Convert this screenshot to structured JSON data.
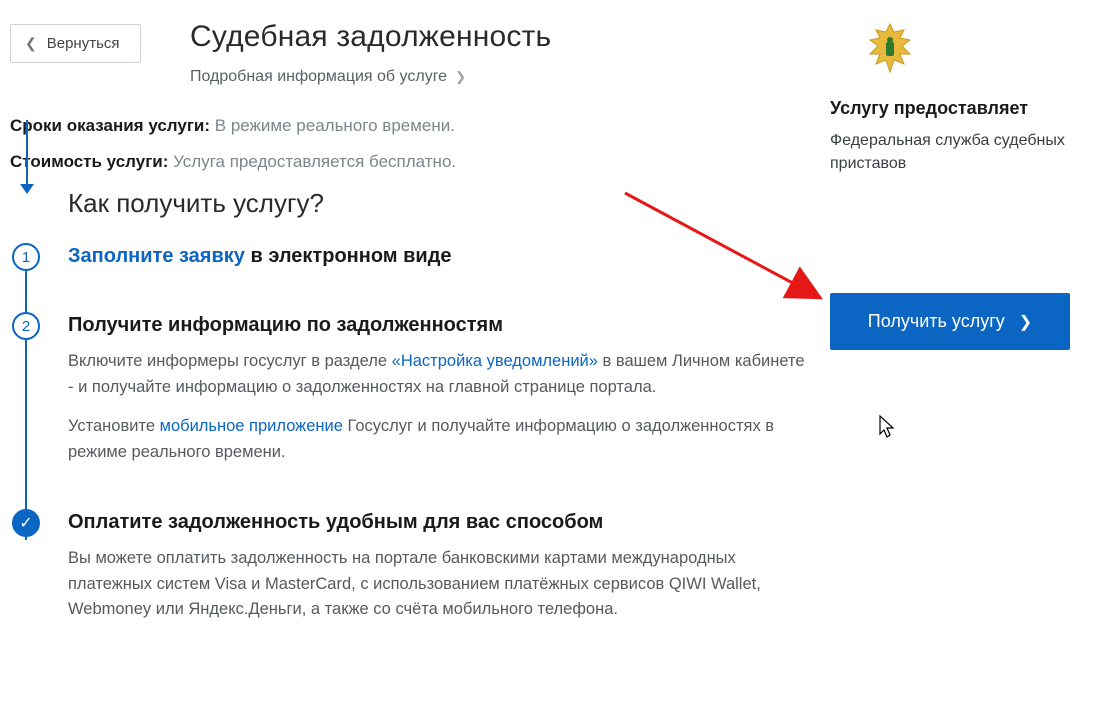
{
  "back_label": "Вернуться",
  "page_title": "Судебная задолженность",
  "more_info": "Подробная информация об услуге",
  "meta": {
    "timing_label": "Сроки оказания услуги:",
    "timing_value": "В режиме реального времени.",
    "cost_label": "Стоимость услуги:",
    "cost_value": "Услуга предоставляется бесплатно."
  },
  "how_title": "Как получить услугу?",
  "steps": [
    {
      "num": "1",
      "title_hl": "Заполните заявку",
      "title_rest": " в электронном виде"
    },
    {
      "num": "2",
      "title": "Получите информацию по задолженностям",
      "p1a": "Включите информеры госуслуг в разделе ",
      "p1link": "«Настройка уведомлений»",
      "p1b": " в вашем Личном кабинете - и получайте информацию о задолженностях на главной странице портала.",
      "p2a": "Установите ",
      "p2link": "мобильное приложение",
      "p2b": " Госуслуг и получайте информацию о задолженностях в режиме реального времени."
    },
    {
      "check": "✓",
      "title": "Оплатите задолженность удобным для вас способом",
      "p1": "Вы можете оплатить задолженность на портале банковскими картами международных платежных систем Visa и MasterCard, с использованием платёжных сервисов QIWI Wallet, Webmoney или Яндекс.Деньги, а также со счёта мобильного телефона."
    }
  ],
  "provider": {
    "heading": "Услугу предоставляет",
    "name": "Федеральная служба судебных приставов"
  },
  "cta_label": "Получить услугу"
}
